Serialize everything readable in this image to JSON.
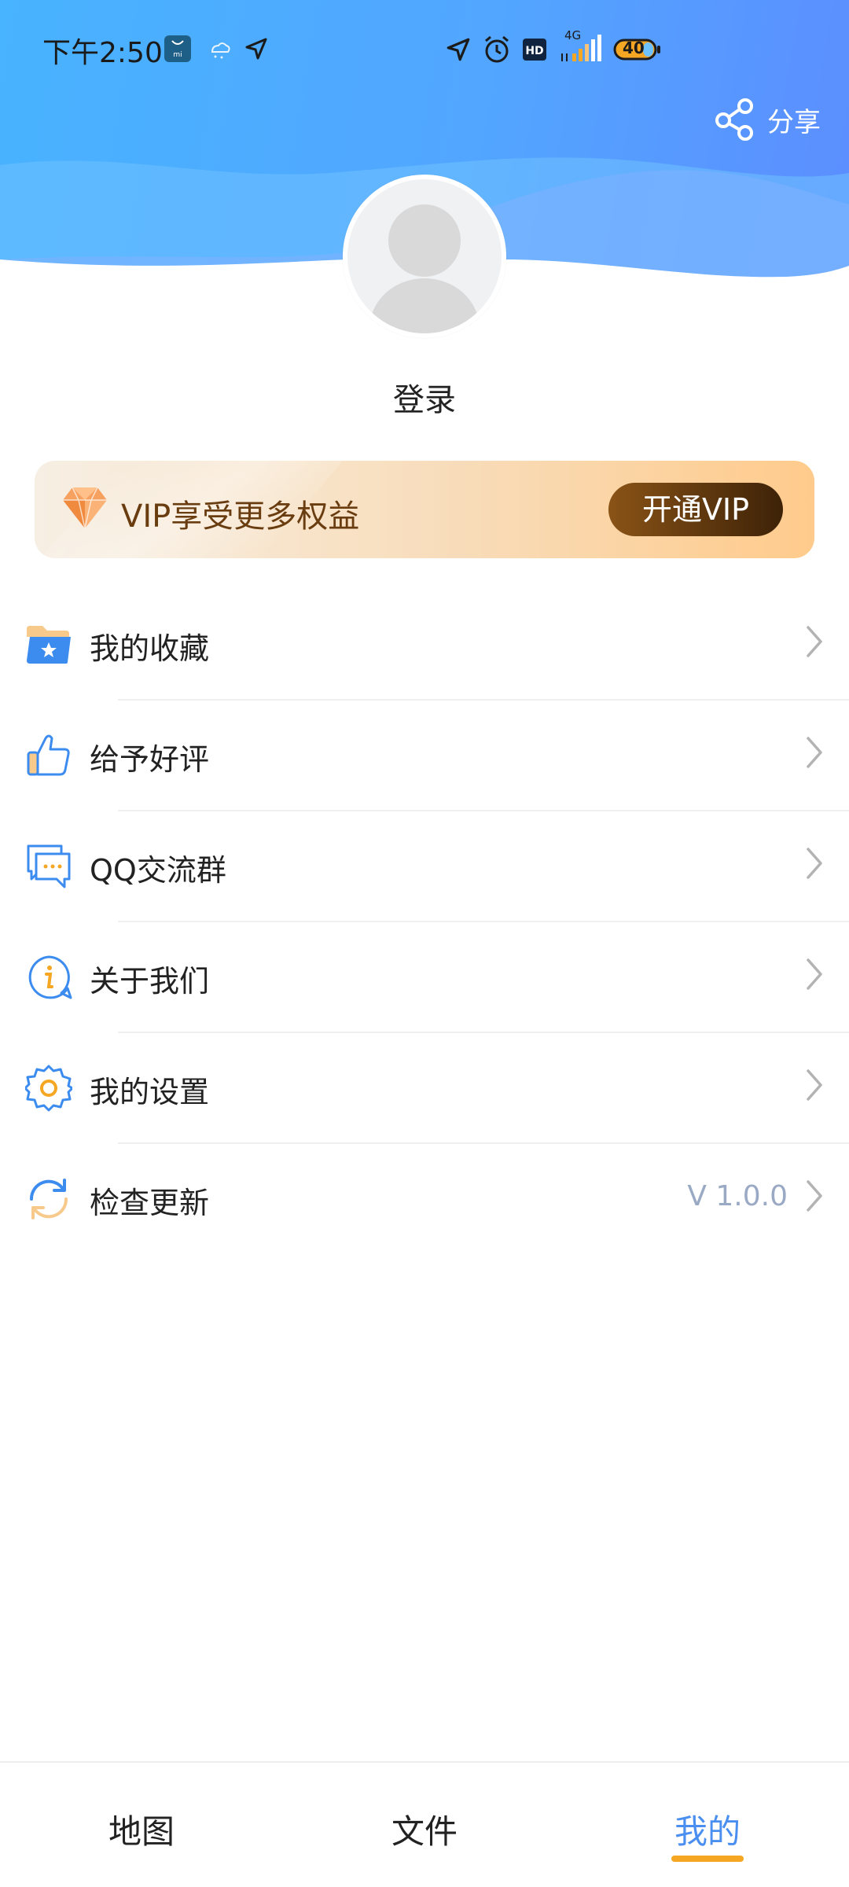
{
  "status_bar": {
    "time": "下午2:50",
    "network": "4G",
    "battery": "40",
    "icons": [
      "mi-app-icon",
      "weather-icon",
      "location-arrow-icon",
      "location-arrow-icon",
      "alarm-icon",
      "hd-icon",
      "signal-icon",
      "battery-icon"
    ]
  },
  "header": {
    "share_label": "分享",
    "login_label": "登录",
    "colors": {
      "gradient_start": "#48b3ff",
      "gradient_end": "#5c8dff"
    }
  },
  "vip": {
    "text": "VIP享受更多权益",
    "button_label": "开通VIP",
    "icon": "diamond-icon"
  },
  "menu": {
    "items": [
      {
        "label": "我的收藏",
        "icon": "favorites-folder-icon",
        "value": ""
      },
      {
        "label": "给予好评",
        "icon": "thumbs-up-icon",
        "value": ""
      },
      {
        "label": "QQ交流群",
        "icon": "chat-icon",
        "value": ""
      },
      {
        "label": "关于我们",
        "icon": "info-icon",
        "value": ""
      },
      {
        "label": "我的设置",
        "icon": "settings-icon",
        "value": ""
      },
      {
        "label": "检查更新",
        "icon": "refresh-icon",
        "value": "V 1.0.0"
      }
    ]
  },
  "bottom_nav": {
    "tabs": [
      {
        "label": "地图",
        "active": false
      },
      {
        "label": "文件",
        "active": false
      },
      {
        "label": "我的",
        "active": true
      }
    ],
    "active_color": "#4a8ff0",
    "indicator_color": "#f5a623"
  }
}
